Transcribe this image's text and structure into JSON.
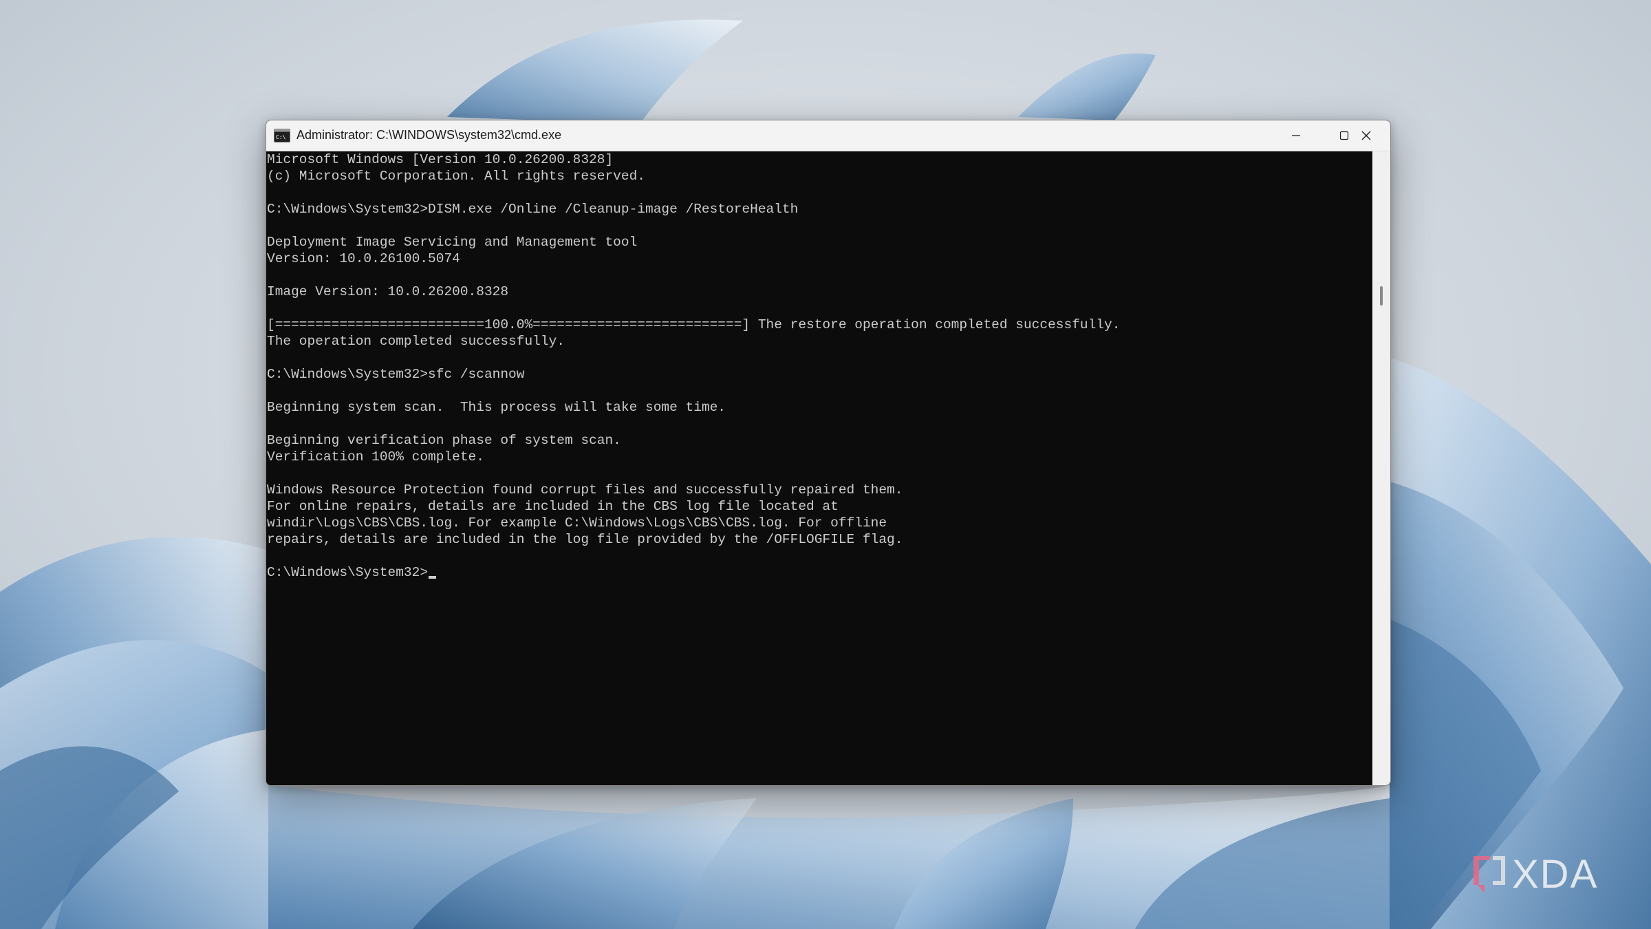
{
  "window": {
    "title": "Administrator: C:\\WINDOWS\\system32\\cmd.exe",
    "icon": "cmd-icon",
    "controls": [
      "minimize-icon",
      "maximize-icon",
      "close-icon"
    ]
  },
  "console": {
    "lines": [
      "Microsoft Windows [Version 10.0.26200.8328]",
      "(c) Microsoft Corporation. All rights reserved.",
      "",
      "C:\\Windows\\System32>DISM.exe /Online /Cleanup-image /RestoreHealth",
      "",
      "Deployment Image Servicing and Management tool",
      "Version: 10.0.26100.5074",
      "",
      "Image Version: 10.0.26200.8328",
      "",
      "[==========================100.0%==========================] The restore operation completed successfully.",
      "The operation completed successfully.",
      "",
      "C:\\Windows\\System32>sfc /scannow",
      "",
      "Beginning system scan.  This process will take some time.",
      "",
      "Beginning verification phase of system scan.",
      "Verification 100% complete.",
      "",
      "Windows Resource Protection found corrupt files and successfully repaired them.",
      "For online repairs, details are included in the CBS log file located at",
      "windir\\Logs\\CBS\\CBS.log. For example C:\\Windows\\Logs\\CBS\\CBS.log. For offline",
      "repairs, details are included in the log file provided by the /OFFLOGFILE flag.",
      ""
    ],
    "prompt": "C:\\Windows\\System32>"
  },
  "watermark": {
    "text": "XDA"
  },
  "colors": {
    "console_bg": "#0c0c0c",
    "console_fg": "#cccccc",
    "titlebar_bg": "#f3f3f3"
  }
}
